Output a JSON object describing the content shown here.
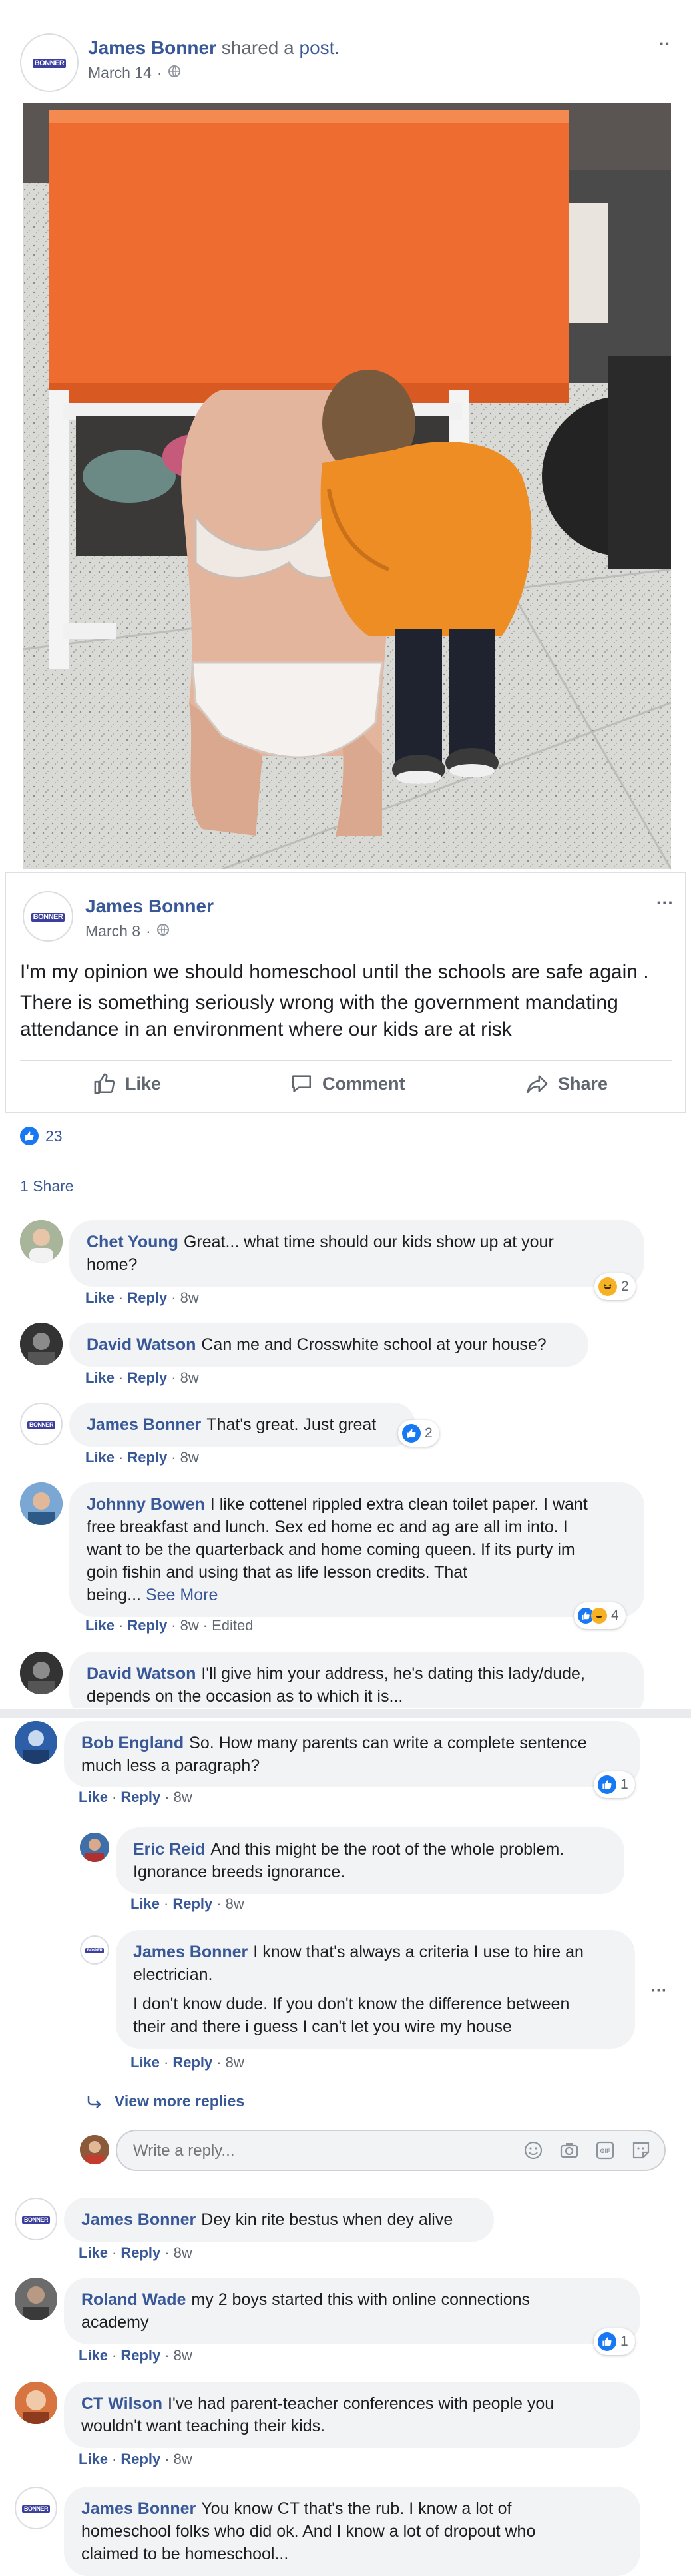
{
  "shared_post": {
    "author": "James Bonner",
    "action": "shared a",
    "post_link": "post.",
    "date": "March 14",
    "menu_glyph": "··"
  },
  "original_post": {
    "author": "James Bonner",
    "date": "March 8",
    "menu_glyph": "···",
    "text_line1": "I'm my opinion we should homeschool until the schools are safe again .",
    "text_line2a": "There is something seriously wrong with the government mandating",
    "text_line2b": "attendance in an environment where our kids are at risk",
    "buttons": {
      "like": "Like",
      "comment": "Comment",
      "share": "Share"
    },
    "reaction_count": "23",
    "share_count": "1 Share"
  },
  "avatar_logo_text": "BONNER",
  "comment_actions": {
    "like": "Like",
    "reply": "Reply",
    "edited": "Edited"
  },
  "comments": [
    {
      "name": "Chet Young",
      "line1": "Great... what time should our kids show up at your",
      "line2": "home?",
      "age": "8w",
      "react": "2"
    },
    {
      "name": "David Watson",
      "line1": "Can me and Crosswhite school at your house?",
      "age": "8w"
    },
    {
      "name": "James Bonner",
      "line1": "That's great. Just great",
      "age": "8w",
      "react": "2"
    },
    {
      "name": "Johnny Bowen",
      "line1": "I like cottenel rippled extra clean toilet paper. I want",
      "line2": "free breakfast and lunch. Sex ed home ec and ag are all im into. I",
      "line3": "want to be the quarterback and home coming queen. If its purty im",
      "line4": "goin fishin and using that as life lesson credits. That",
      "line5": "being...",
      "see_more": "See More",
      "age": "8w",
      "react": "4"
    },
    {
      "name": "David Watson",
      "line1": "I'll give him your address, he's dating this lady/dude,",
      "line2": "depends on the occasion as to which it is..."
    },
    {
      "name": "Bob England",
      "line1": "So. How many parents can write a complete sentence",
      "line2": "much less a paragraph?",
      "age": "8w",
      "react": "1"
    },
    {
      "name": "Eric Reid",
      "line1": "And this might be the root of the whole problem.",
      "line2": "Ignorance breeds ignorance.",
      "age": "8w"
    },
    {
      "name": "James Bonner",
      "line1": "I know that's always a criteria I use to hire an",
      "line2": "electrician.",
      "line3": "I don't know dude. If you don't know the difference between",
      "line4": "their and there i guess I can't let you wire my house",
      "age": "8w"
    },
    {
      "name": "James Bonner",
      "line1": "Dey kin rite bestus when dey alive",
      "age": "8w"
    },
    {
      "name": "Roland Wade",
      "line1": "my 2 boys started this with online connections",
      "line2": "academy",
      "age": "8w",
      "react": "1"
    },
    {
      "name": "CT Wilson",
      "line1": "I've had parent-teacher conferences with people you",
      "line2": "wouldn't want teaching their kids.",
      "age": "8w"
    },
    {
      "name": "James Bonner",
      "line1": "You know CT that's the rub. I know a lot of",
      "line2": "homeschool folks who did ok. And I know a lot of dropout who",
      "line3": "claimed to be homeschool..."
    }
  ],
  "view_more_replies": "View more replies",
  "reply_placeholder": "Write a reply...",
  "colors": {
    "link_blue": "#385898",
    "like_blue": "#1877f2",
    "bubble_bg": "#f2f3f5",
    "muted": "#606770"
  },
  "icons": [
    "globe-icon",
    "thumbs-up-icon",
    "comment-icon",
    "share-arrow-icon",
    "emoji-icon",
    "camera-icon",
    "gif-icon",
    "sticker-icon",
    "reply-arrow-icon",
    "haha-icon"
  ]
}
